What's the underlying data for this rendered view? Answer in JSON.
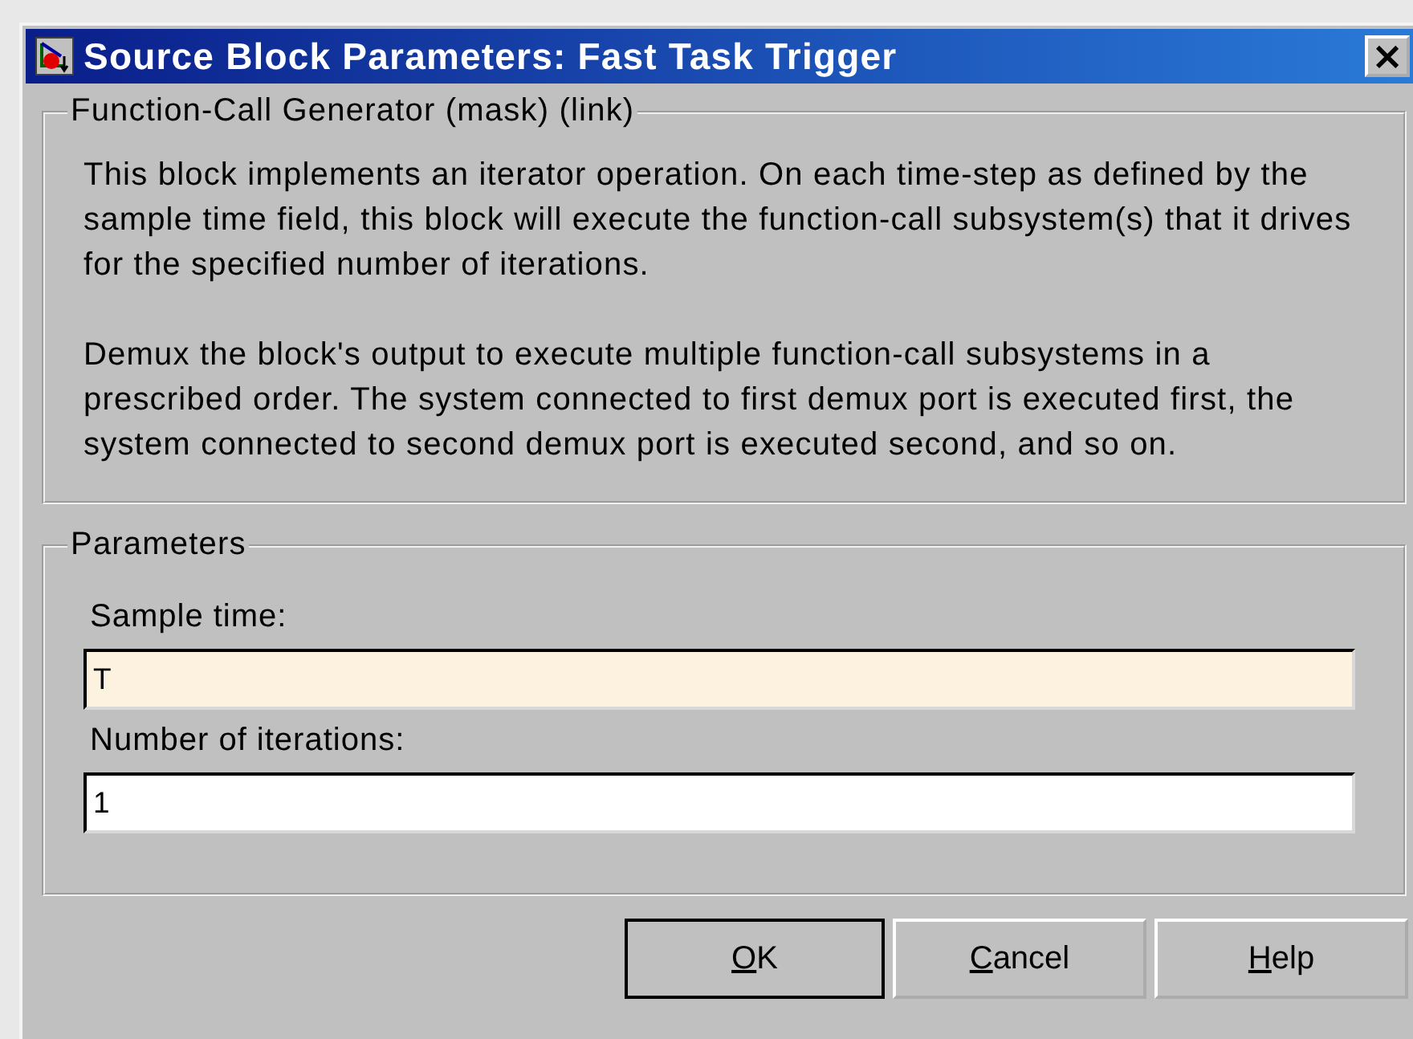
{
  "window": {
    "title": "Source Block Parameters: Fast Task Trigger",
    "close": "×"
  },
  "description": {
    "legend": "Function-Call Generator (mask) (link)",
    "paragraphs": [
      "This block implements an iterator operation. On each time-step as defined by the sample time field, this block will execute the function-call subsystem(s) that it drives for the specified number of iterations.",
      "Demux the block's output to execute multiple function-call subsystems in a prescribed order.  The system connected to first demux port is executed first, the system connected to second demux port is executed second, and so on."
    ]
  },
  "parameters": {
    "legend": "Parameters",
    "fields": [
      {
        "label": "Sample time:",
        "value": "T",
        "focused": true
      },
      {
        "label": "Number of iterations:",
        "value": "1",
        "focused": false
      }
    ]
  },
  "buttons": [
    {
      "mnemonic": "O",
      "rest": "K",
      "default": true
    },
    {
      "mnemonic": "C",
      "rest": "ancel",
      "default": false
    },
    {
      "mnemonic": "H",
      "rest": "elp",
      "default": false
    }
  ]
}
